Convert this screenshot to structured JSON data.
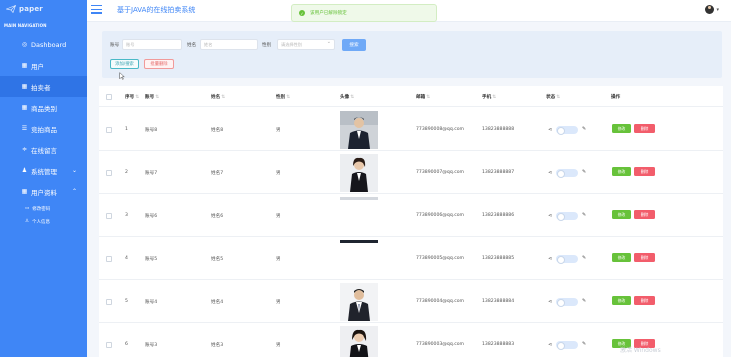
{
  "sidebar": {
    "logo_text": "paper",
    "section_header": "MAIN NAVIGATION",
    "items": [
      {
        "label": "Dashboard",
        "icon": "dashboard-icon"
      },
      {
        "label": "用户",
        "icon": "grid-icon"
      },
      {
        "label": "拍卖者",
        "icon": "grid-icon"
      },
      {
        "label": "商品类别",
        "icon": "grid-icon"
      },
      {
        "label": "竞拍商品",
        "icon": "list-icon"
      },
      {
        "label": "在线留言",
        "icon": "chat-icon"
      },
      {
        "label": "系统管理",
        "icon": "person-icon"
      },
      {
        "label": "用户资料",
        "icon": "grid-icon"
      }
    ],
    "sub_items": [
      {
        "label": "修改密码",
        "icon": "folder-icon"
      },
      {
        "label": "个人信息",
        "icon": "person-icon"
      }
    ],
    "active_item": "拍卖者"
  },
  "topbar": {
    "title": "基于JAVA的在线拍卖系统",
    "toast": "该用户已解除锁定"
  },
  "search": {
    "account_label": "账号",
    "account_placeholder": "账号",
    "name_label": "姓名",
    "name_placeholder": "姓名",
    "gender_label": "性别",
    "gender_placeholder": "请选择性别",
    "search_button": "搜索",
    "add_button": "添加/搜索",
    "bulk_delete_button": "批量删除"
  },
  "table": {
    "headers": [
      "序号",
      "账号",
      "姓名",
      "性别",
      "头像",
      "邮箱",
      "手机",
      "状态",
      "操作"
    ],
    "edit_label": "修改",
    "delete_label": "删除",
    "rows": [
      {
        "index": "1",
        "account": "账号8",
        "name": "姓名8",
        "gender": "男",
        "email": "773890008@qq.com",
        "phone": "13823888888",
        "photo": "man-suit"
      },
      {
        "index": "2",
        "account": "账号7",
        "name": "姓名7",
        "gender": "男",
        "email": "773890007@qq.com",
        "phone": "13823888887",
        "photo": "woman-suit"
      },
      {
        "index": "3",
        "account": "账号6",
        "name": "姓名6",
        "gender": "男",
        "email": "773890006@qq.com",
        "phone": "13823888886",
        "photo": "cropped"
      },
      {
        "index": "4",
        "account": "账号5",
        "name": "姓名5",
        "gender": "男",
        "email": "773890005@qq.com",
        "phone": "13823888885",
        "photo": "cropped-top"
      },
      {
        "index": "5",
        "account": "账号4",
        "name": "姓名4",
        "gender": "男",
        "email": "773890004@qq.com",
        "phone": "13823888884",
        "photo": "man-suit-2"
      },
      {
        "index": "6",
        "account": "账号3",
        "name": "姓名3",
        "gender": "男",
        "email": "773890003@qq.com",
        "phone": "13823888883",
        "photo": "woman-suit-2"
      }
    ]
  },
  "watermark": "激活 Windows",
  "colors": {
    "sidebar": "#3f86f6",
    "edit": "#67c23a",
    "delete": "#f25d6b",
    "toast": "#67c23a"
  }
}
